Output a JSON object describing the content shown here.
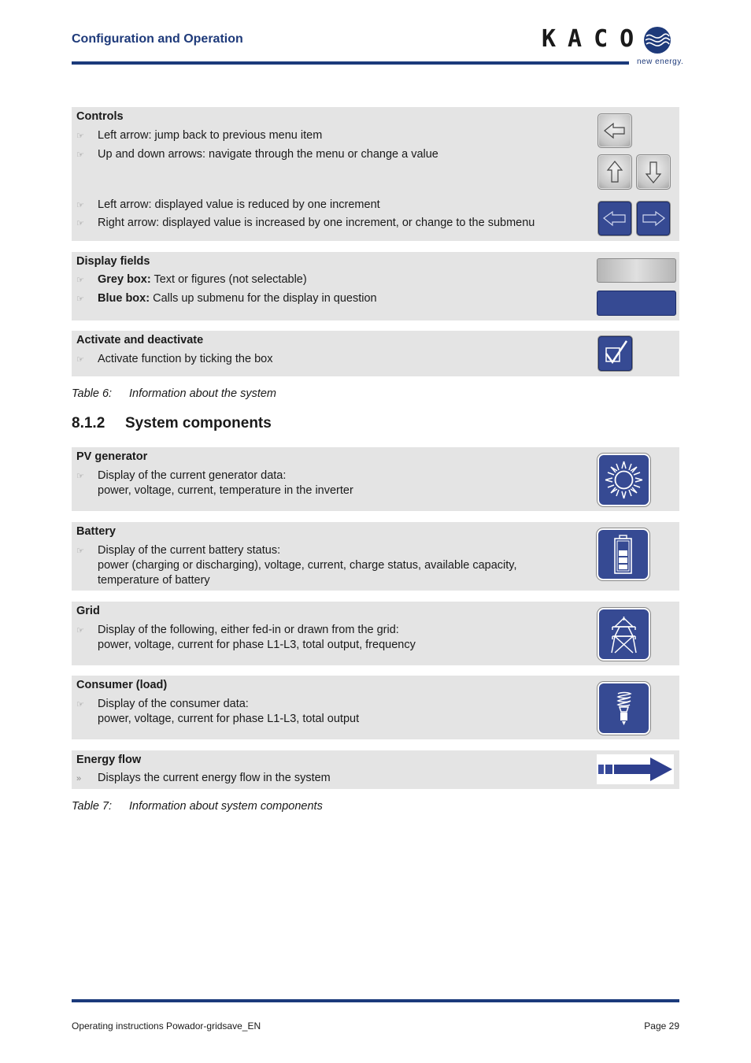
{
  "header": {
    "section_title": "Configuration and Operation",
    "logo_text": "KACO",
    "logo_tagline": "new energy."
  },
  "table6": {
    "rows": [
      {
        "title": "Controls",
        "bullets": [
          "Left arrow: jump back to previous menu item",
          "Up and down arrows: navigate through the menu or change a value",
          "Left arrow: displayed value is reduced by one increment",
          "Right arrow: displayed value is increased by one increment, or change to the submenu"
        ],
        "icons": [
          "grey-left-arrow-button",
          "grey-up-arrow-button",
          "grey-down-arrow-button",
          "blue-left-arrow-button",
          "blue-right-arrow-button"
        ]
      },
      {
        "title": "Display fields",
        "bullets": [
          {
            "bold": "Grey box:",
            "text": " Text or figures (not selectable)"
          },
          {
            "bold": "Blue box:",
            "text": " Calls up submenu for the display in question"
          }
        ],
        "icons": [
          "grey-display-field",
          "blue-display-field"
        ]
      },
      {
        "title": "Activate and deactivate",
        "bullets": [
          "Activate function by ticking the box"
        ],
        "icons": [
          "checkbox-checked"
        ]
      }
    ],
    "caption_number": "Table 6:",
    "caption_text": "Information about the system"
  },
  "section": {
    "number": "8.1.2",
    "title": "System components"
  },
  "table7": {
    "rows": [
      {
        "title": "PV generator",
        "lines": [
          "Display of the current generator data:",
          "power, voltage, current, temperature in the inverter"
        ],
        "icon": "sun-icon"
      },
      {
        "title": "Battery",
        "lines": [
          "Display of the current battery status:",
          "power (charging or discharging), voltage, current, charge status, available capacity,",
          "temperature of battery"
        ],
        "icon": "battery-icon"
      },
      {
        "title": "Grid",
        "lines": [
          "Display of the following, either fed-in or drawn from the grid:",
          "power, voltage, current for phase L1-L3, total output, frequency"
        ],
        "icon": "power-pylon-icon"
      },
      {
        "title": "Consumer (load)",
        "lines": [
          "Display of the consumer data:",
          "power, voltage, current for phase L1-L3, total output"
        ],
        "icon": "light-bulb-icon"
      },
      {
        "title": "Energy flow",
        "lines": [
          "Displays the current energy flow in the system"
        ],
        "icon": "energy-flow-arrow-icon"
      }
    ],
    "caption_number": "Table 7:",
    "caption_text": "Information about system components"
  },
  "glyphs": {
    "hand_bullet": "☞",
    "chevron_bullet": "»"
  },
  "colors": {
    "brand_blue": "#1b3a7b",
    "icon_blue": "#364a93",
    "box_grey": "#e4e4e4"
  },
  "footer": {
    "document": "Operating instructions Powador-gridsave_EN",
    "page": "Page 29"
  }
}
